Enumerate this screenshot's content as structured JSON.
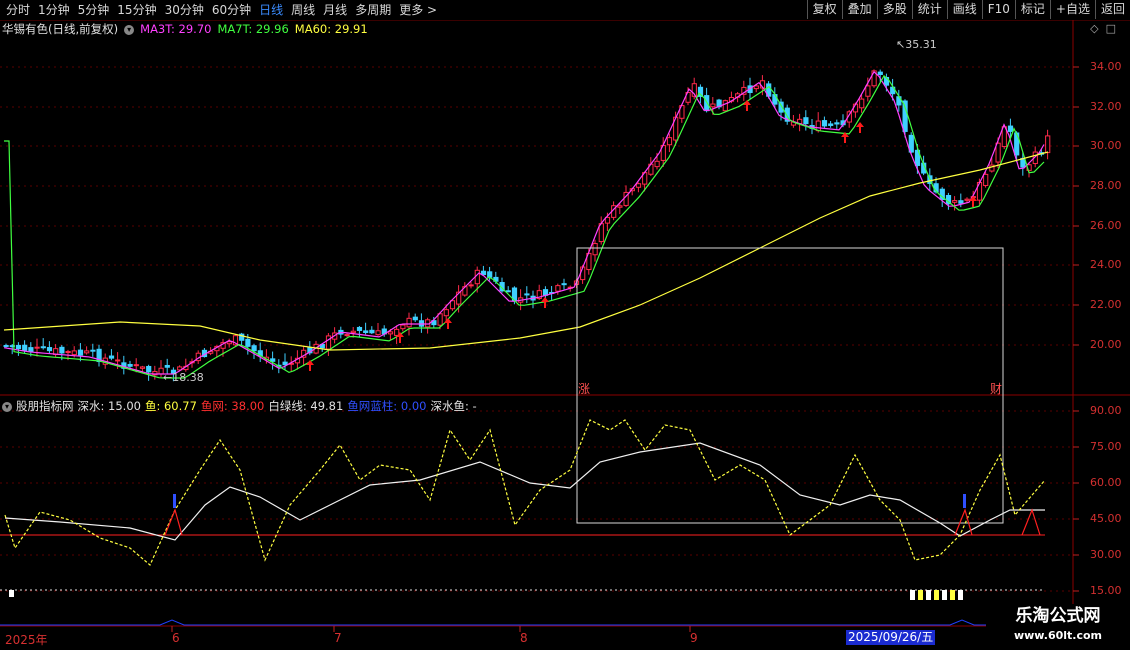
{
  "periods": [
    {
      "label": "分时",
      "active": false
    },
    {
      "label": "1分钟",
      "active": false
    },
    {
      "label": "5分钟",
      "active": false
    },
    {
      "label": "15分钟",
      "active": false
    },
    {
      "label": "30分钟",
      "active": false
    },
    {
      "label": "60分钟",
      "active": false
    },
    {
      "label": "日线",
      "active": true
    },
    {
      "label": "周线",
      "active": false
    },
    {
      "label": "月线",
      "active": false
    },
    {
      "label": "多周期",
      "active": false
    },
    {
      "label": "更多 >",
      "active": false
    }
  ],
  "tools": [
    "复权",
    "叠加",
    "多股",
    "统计",
    "画线",
    "F10",
    "标记",
    "+自选",
    "返回"
  ],
  "info": {
    "stock": "华锡有色(日线,前复权)",
    "ma1": "MA3T: 29.70",
    "ma2": "MA7T: 29.96",
    "ma3": "MA60: 29.91",
    "color_ma1": "#ff40ff",
    "color_ma2": "#40ff40",
    "color_ma3": "#ffff40"
  },
  "indicator": {
    "name": "股朋指标网",
    "shenshui": "深水: 15.00",
    "yu": "鱼: 60.77",
    "yuwang": "鱼网: 38.00",
    "bailvxian": "白绿线: 49.81",
    "yuwanglanzhu": "鱼网蓝柱: 0.00",
    "shenshuiyu": "深水鱼: -"
  },
  "price_axis": [
    "34.00",
    "32.00",
    "30.00",
    "28.00",
    "26.00",
    "24.00",
    "22.00",
    "20.00"
  ],
  "ind_axis": [
    "90.00",
    "75.00",
    "60.00",
    "45.00",
    "30.00",
    "15.00"
  ],
  "annotations": {
    "high": "35.31",
    "low": "18.38",
    "zhang": "涨",
    "cai": "财"
  },
  "dates": [
    {
      "label": "2025年"
    },
    {
      "label": "6"
    },
    {
      "label": "7"
    },
    {
      "label": "8"
    },
    {
      "label": "9"
    }
  ],
  "cursor_date": "2025/09/26/五",
  "watermark": {
    "line1": "乐淘公式网",
    "line2": "www.60lt.com"
  }
}
